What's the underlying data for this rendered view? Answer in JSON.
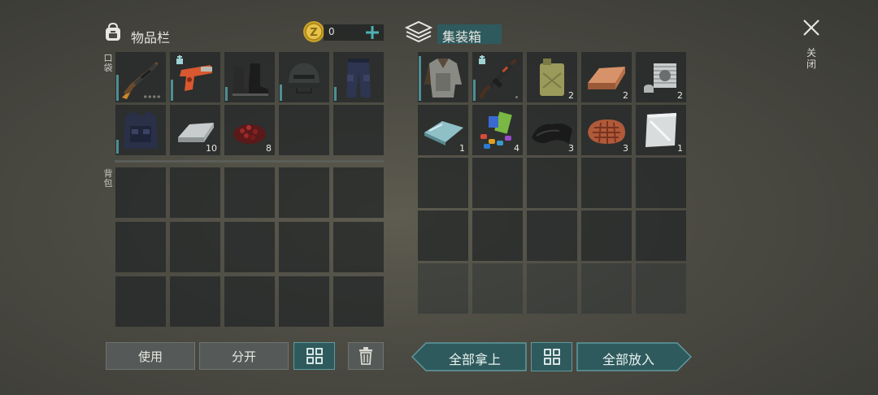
{
  "inventory": {
    "title": "物品栏",
    "coin_value": "0",
    "pocket_label": "口袋",
    "backpack_label": "背包"
  },
  "container": {
    "title": "集装箱"
  },
  "pocket_items": [
    {
      "name": "hunting-rifle",
      "count": "",
      "charge": 0.55,
      "dots": "full"
    },
    {
      "name": "flare-gun",
      "count": "",
      "charge": 0.45,
      "badge": true
    },
    {
      "name": "combat-boots",
      "count": "",
      "charge": 0.3
    },
    {
      "name": "tactical-helmet",
      "count": "",
      "charge": 0.35
    },
    {
      "name": "tactical-pants",
      "count": "",
      "charge": 0.3
    },
    {
      "name": "body-armor-vest",
      "count": "",
      "charge": 0.3
    },
    {
      "name": "iron-ingot",
      "count": "10"
    },
    {
      "name": "red-berries",
      "count": "8"
    }
  ],
  "container_items": [
    {
      "name": "armored-jacket",
      "count": "",
      "charge": 0.95
    },
    {
      "name": "assault-rifle",
      "count": "",
      "charge": 0.45,
      "badge": true,
      "dots": "one"
    },
    {
      "name": "jerry-can",
      "count": "2"
    },
    {
      "name": "copper-ingot",
      "count": "2"
    },
    {
      "name": "engine-cylinder",
      "count": "2"
    },
    {
      "name": "glass-sheet",
      "count": "1"
    },
    {
      "name": "colorful-parts",
      "count": "4"
    },
    {
      "name": "rubber-sheet",
      "count": "3"
    },
    {
      "name": "raw-steak",
      "count": "3"
    },
    {
      "name": "metal-plate",
      "count": "1"
    }
  ],
  "buttons": {
    "use": "使用",
    "split": "分开",
    "take_all": "全部拿上",
    "put_all": "全部放入",
    "close": "关闭"
  },
  "colors": {
    "teal_accent": "#4e8e93",
    "button_teal": "#2f5a5d",
    "button_gray": "#555a58"
  }
}
